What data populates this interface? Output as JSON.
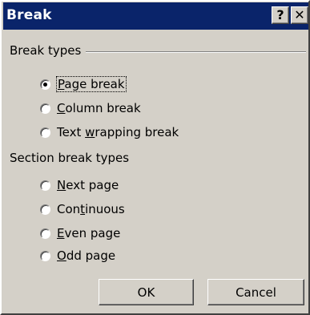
{
  "window": {
    "title": "Break",
    "help_glyph": "?",
    "close_glyph": "✕"
  },
  "break_types": {
    "label": "Break types",
    "options": [
      {
        "pre": "",
        "key": "P",
        "post": "age break",
        "checked": true
      },
      {
        "pre": "",
        "key": "C",
        "post": "olumn break",
        "checked": false
      },
      {
        "pre": "Text ",
        "key": "w",
        "post": "rapping break",
        "checked": false
      }
    ]
  },
  "section_break_types": {
    "label": "Section break types",
    "options": [
      {
        "pre": "",
        "key": "N",
        "post": "ext page",
        "checked": false
      },
      {
        "pre": "Con",
        "key": "t",
        "post": "inuous",
        "checked": false
      },
      {
        "pre": "",
        "key": "E",
        "post": "ven page",
        "checked": false
      },
      {
        "pre": "",
        "key": "O",
        "post": "dd page",
        "checked": false
      }
    ]
  },
  "buttons": {
    "ok": "OK",
    "cancel": "Cancel"
  }
}
